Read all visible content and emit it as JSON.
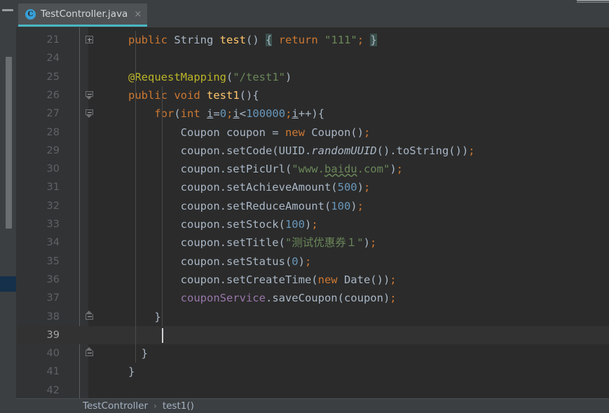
{
  "window": {
    "hide_bar_icon": "minimize-icon"
  },
  "tab": {
    "icon": "java-class-icon",
    "icon_letter": "C",
    "label": "TestController.java",
    "close": "×"
  },
  "editor": {
    "lines": [
      {
        "num": "21",
        "fold": "plus",
        "indent": 0,
        "current": false,
        "tokens": [
          {
            "t": "public ",
            "c": "kw"
          },
          {
            "t": "String",
            "c": "typ"
          },
          {
            "t": " ",
            "c": "typ"
          },
          {
            "t": "test",
            "c": "mth"
          },
          {
            "t": "()",
            "c": "typ"
          },
          {
            "t": " ",
            "c": "typ"
          },
          {
            "t": "{",
            "c": "brace-hl"
          },
          {
            "t": " ",
            "c": "typ"
          },
          {
            "t": "return",
            "c": "kw"
          },
          {
            "t": " ",
            "c": "typ"
          },
          {
            "t": "\"111\"",
            "c": "str"
          },
          {
            "t": ";",
            "c": "semi"
          },
          {
            "t": " ",
            "c": "typ"
          },
          {
            "t": "}",
            "c": "brace-hl"
          }
        ]
      },
      {
        "num": "24",
        "fold": "",
        "indent": 0,
        "current": false,
        "tokens": []
      },
      {
        "num": "25",
        "fold": "",
        "indent": 0,
        "current": false,
        "tokens": [
          {
            "t": "@RequestMapping",
            "c": "ann"
          },
          {
            "t": "(",
            "c": "typ"
          },
          {
            "t": "\"/test1\"",
            "c": "str"
          },
          {
            "t": ")",
            "c": "typ"
          }
        ]
      },
      {
        "num": "26",
        "fold": "minus-top",
        "indent": 0,
        "current": false,
        "tokens": [
          {
            "t": "public ",
            "c": "kw"
          },
          {
            "t": "void",
            "c": "kw"
          },
          {
            "t": " ",
            "c": "typ"
          },
          {
            "t": "test1",
            "c": "mth"
          },
          {
            "t": "(){",
            "c": "typ"
          }
        ]
      },
      {
        "num": "27",
        "fold": "minus-top",
        "indent": 1,
        "current": false,
        "tokens": [
          {
            "t": "    ",
            "c": "typ"
          },
          {
            "t": "for",
            "c": "kw"
          },
          {
            "t": "(",
            "c": "typ"
          },
          {
            "t": "int",
            "c": "kw"
          },
          {
            "t": " ",
            "c": "typ"
          },
          {
            "t": "i",
            "c": "loc"
          },
          {
            "t": "=",
            "c": "typ"
          },
          {
            "t": "0",
            "c": "num"
          },
          {
            "t": ";",
            "c": "semi"
          },
          {
            "t": "i",
            "c": "loc"
          },
          {
            "t": "<",
            "c": "typ"
          },
          {
            "t": "100000",
            "c": "num"
          },
          {
            "t": ";",
            "c": "semi"
          },
          {
            "t": "i",
            "c": "loc"
          },
          {
            "t": "++){",
            "c": "typ"
          }
        ]
      },
      {
        "num": "28",
        "fold": "",
        "indent": 2,
        "current": false,
        "tokens": [
          {
            "t": "        Coupon coupon = ",
            "c": "typ"
          },
          {
            "t": "new",
            "c": "kw"
          },
          {
            "t": " Coupon()",
            "c": "typ"
          },
          {
            "t": ";",
            "c": "semi"
          }
        ]
      },
      {
        "num": "29",
        "fold": "",
        "indent": 2,
        "current": false,
        "tokens": [
          {
            "t": "        coupon.setCode(UUID.",
            "c": "typ"
          },
          {
            "t": "randomUUID",
            "c": "stat"
          },
          {
            "t": "().toString())",
            "c": "typ"
          },
          {
            "t": ";",
            "c": "semi"
          }
        ]
      },
      {
        "num": "30",
        "fold": "",
        "indent": 2,
        "current": false,
        "tokens": [
          {
            "t": "        coupon.setPicUrl(",
            "c": "typ"
          },
          {
            "t": "\"www.",
            "c": "str"
          },
          {
            "t": "baidu",
            "c": "typo"
          },
          {
            "t": ".com\"",
            "c": "str"
          },
          {
            "t": ")",
            "c": "typ"
          },
          {
            "t": ";",
            "c": "semi"
          }
        ]
      },
      {
        "num": "31",
        "fold": "",
        "indent": 2,
        "current": false,
        "tokens": [
          {
            "t": "        coupon.setAchieveAmount(",
            "c": "typ"
          },
          {
            "t": "500",
            "c": "num"
          },
          {
            "t": ")",
            "c": "typ"
          },
          {
            "t": ";",
            "c": "semi"
          }
        ]
      },
      {
        "num": "32",
        "fold": "",
        "indent": 2,
        "current": false,
        "tokens": [
          {
            "t": "        coupon.setReduceAmount(",
            "c": "typ"
          },
          {
            "t": "100",
            "c": "num"
          },
          {
            "t": ")",
            "c": "typ"
          },
          {
            "t": ";",
            "c": "semi"
          }
        ]
      },
      {
        "num": "33",
        "fold": "",
        "indent": 2,
        "current": false,
        "tokens": [
          {
            "t": "        coupon.setStock(",
            "c": "typ"
          },
          {
            "t": "100",
            "c": "num"
          },
          {
            "t": ")",
            "c": "typ"
          },
          {
            "t": ";",
            "c": "semi"
          }
        ]
      },
      {
        "num": "34",
        "fold": "",
        "indent": 2,
        "current": false,
        "tokens": [
          {
            "t": "        coupon.setTitle(",
            "c": "typ"
          },
          {
            "t": "\"测试优惠券１\"",
            "c": "str"
          },
          {
            "t": ")",
            "c": "typ"
          },
          {
            "t": ";",
            "c": "semi"
          }
        ]
      },
      {
        "num": "35",
        "fold": "",
        "indent": 2,
        "current": false,
        "tokens": [
          {
            "t": "        coupon.setStatus(",
            "c": "typ"
          },
          {
            "t": "0",
            "c": "num"
          },
          {
            "t": ")",
            "c": "typ"
          },
          {
            "t": ";",
            "c": "semi"
          }
        ]
      },
      {
        "num": "36",
        "fold": "",
        "indent": 2,
        "current": false,
        "tokens": [
          {
            "t": "        coupon.setCreateTime(",
            "c": "typ"
          },
          {
            "t": "new",
            "c": "kw"
          },
          {
            "t": " Date())",
            "c": "typ"
          },
          {
            "t": ";",
            "c": "semi"
          }
        ]
      },
      {
        "num": "37",
        "fold": "",
        "indent": 2,
        "current": false,
        "tokens": [
          {
            "t": "        ",
            "c": "typ"
          },
          {
            "t": "couponService",
            "c": "fld"
          },
          {
            "t": ".saveCoupon(coupon)",
            "c": "typ"
          },
          {
            "t": ";",
            "c": "semi"
          }
        ]
      },
      {
        "num": "38",
        "fold": "minus-bot",
        "indent": 1,
        "current": false,
        "tokens": [
          {
            "t": "    }",
            "c": "typ"
          }
        ]
      },
      {
        "num": "39",
        "fold": "",
        "indent": 1,
        "current": true,
        "caret": true,
        "tokens": []
      },
      {
        "num": "40",
        "fold": "minus-bot",
        "indent": 0,
        "current": false,
        "tokens": [
          {
            "t": "  }",
            "c": "typ"
          }
        ]
      },
      {
        "num": "41",
        "fold": "",
        "indent": 0,
        "current": false,
        "tokens": [
          {
            "t": "}",
            "c": "typ"
          }
        ]
      },
      {
        "num": "42",
        "fold": "",
        "indent": 0,
        "current": false,
        "tokens": []
      }
    ]
  },
  "breadcrumb": {
    "class": "TestController",
    "separator": "›",
    "method": "test1()"
  },
  "colors": {
    "editor_bg": "#2b2b2b",
    "gutter_bg": "#313335",
    "chrome_bg": "#3c3f41",
    "current_line": "#323232",
    "tab_underline": "#4ab6c4",
    "keyword": "#cc7832",
    "string": "#6a8759",
    "number": "#6897bb",
    "method": "#ffc66d",
    "annotation": "#bbb529",
    "field": "#9876aa",
    "default_text": "#a9b7c6",
    "line_number": "#606366"
  }
}
